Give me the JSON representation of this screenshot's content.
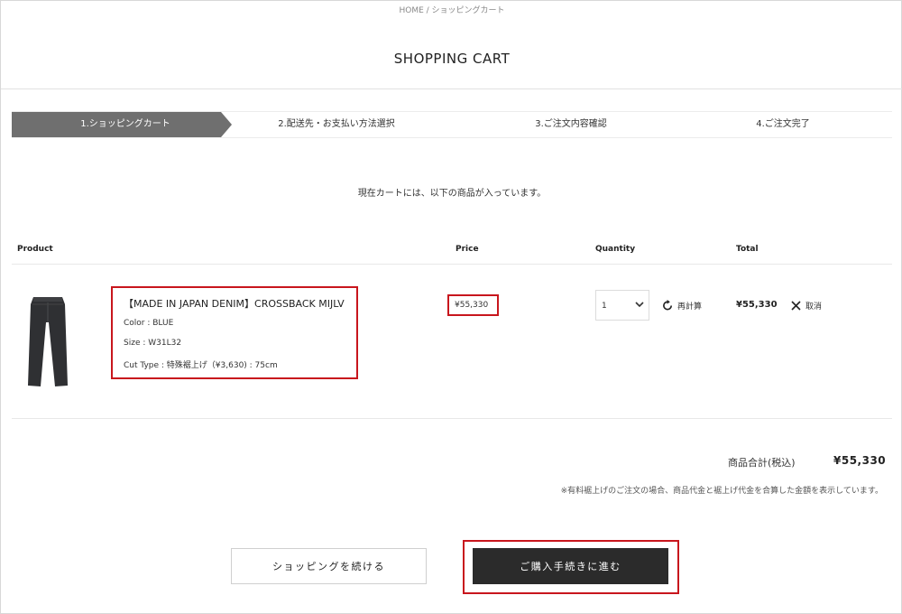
{
  "breadcrumb": "HOME / ショッピングカート",
  "title": "SHOPPING CART",
  "steps": [
    {
      "label": "1.ショッピングカート"
    },
    {
      "label": "2.配送先・お支払い方法選択"
    },
    {
      "label": "3.ご注文内容確認"
    },
    {
      "label": "4.ご注文完了"
    }
  ],
  "notice": "現在カートには、以下の商品が入っています。",
  "table": {
    "headers": {
      "product": "Product",
      "price": "Price",
      "quantity": "Quantity",
      "total": "Total"
    }
  },
  "item": {
    "name": "【MADE IN JAPAN DENIM】CROSSBACK MIJLV",
    "color": "Color : BLUE",
    "size": "Size : W31L32",
    "cut_type": "Cut Type : 特殊裾上げ（¥3,630) : 75cm",
    "price": "¥55,330",
    "quantity": "1",
    "recalc_label": "再計算",
    "total": "¥55,330",
    "remove_label": "取消"
  },
  "summary": {
    "label": "商品合計(税込)",
    "value": "¥55,330",
    "footnote": "※有料裾上げのご注文の場合、商品代金と裾上げ代金を合算した金額を表示しています。"
  },
  "buttons": {
    "continue": "ショッピングを続ける",
    "checkout": "ご購入手続きに進む"
  },
  "colors": {
    "accent_highlight": "#c8161d",
    "step_active": "#6f6f6f",
    "checkout_bg": "#2b2b2b"
  },
  "icons": {
    "recalc": "refresh-icon",
    "remove": "close-icon",
    "select": "chevron-down-icon"
  }
}
